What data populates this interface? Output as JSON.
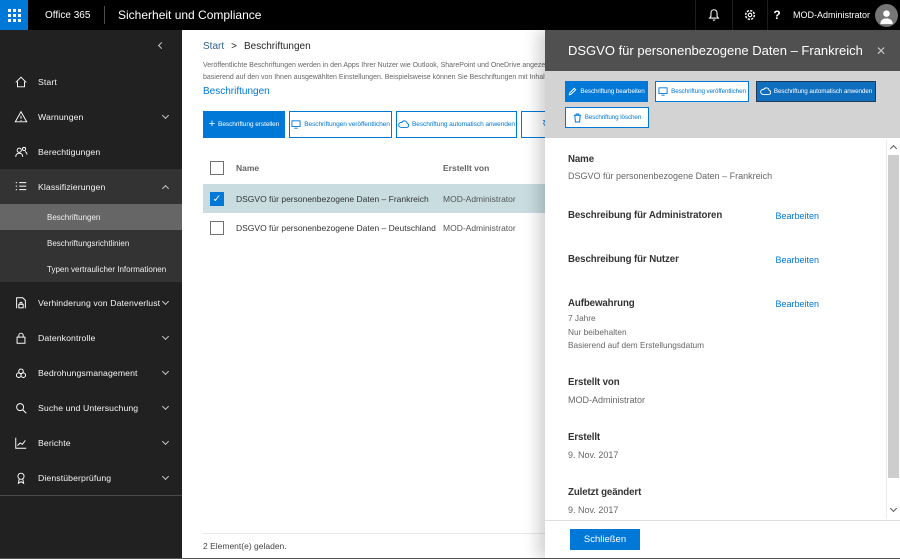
{
  "topbar": {
    "brand": "Office 365",
    "product": "Sicherheit und Compliance",
    "user": "MOD-Administrator",
    "help": "?"
  },
  "sidebar": {
    "items": [
      {
        "label": "Start"
      },
      {
        "label": "Warnungen"
      },
      {
        "label": "Berechtigungen"
      },
      {
        "label": "Klassifizierungen"
      },
      {
        "label": "Verhinderung von Datenverlust"
      },
      {
        "label": "Datenkontrolle"
      },
      {
        "label": "Bedrohungsmanagement"
      },
      {
        "label": "Suche und Untersuchung"
      },
      {
        "label": "Berichte"
      },
      {
        "label": "Dienstüberprüfung"
      }
    ],
    "klassifizierungen_children": [
      {
        "label": "Beschriftungen",
        "selected": true
      },
      {
        "label": "Beschriftungsrichtlinien",
        "selected": false
      },
      {
        "label": "Typen vertraulicher Informationen",
        "selected": false
      }
    ]
  },
  "main": {
    "breadcrumb": {
      "home": "Start",
      "separator": ">",
      "current": "Beschriftungen"
    },
    "description_line1": "Veröffentlichte Beschriftungen werden in den Apps Ihrer Nutzer wie Outlook, SharePoint und OneDrive angezeigt,",
    "description_line2": "basierend auf den von Ihnen ausgewählten Einstellungen. Beispielsweise können Sie Beschriftungen mit Inhalten",
    "link": "Beschriftungen",
    "buttons": {
      "create": "Beschriftung erstellen",
      "publish": "Beschriftungen veröffentlichen",
      "auto_apply": "Beschriftung automatisch anwenden",
      "refresh": "Aktualisieren"
    },
    "table": {
      "columns": {
        "name": "Name",
        "created_by": "Erstellt von"
      },
      "rows": [
        {
          "name": "DSGVO für personenbezogene Daten – Frankreich",
          "created_by": "MOD-Administrator",
          "selected": true
        },
        {
          "name": "DSGVO für personenbezogene Daten – Deutschland",
          "created_by": "MOD-Administrator",
          "selected": false
        }
      ]
    },
    "status": "2 Element(e) geladen."
  },
  "panel": {
    "title": "DSGVO für personenbezogene Daten – Frankreich",
    "buttons": {
      "edit": "Beschriftung bearbeiten",
      "publish": "Beschriftung veröffentlichen",
      "auto_apply": "Beschriftung automatisch anwenden",
      "delete": "Beschriftung löschen"
    },
    "sections": {
      "name": {
        "label": "Name",
        "value": "DSGVO für personenbezogene Daten – Frankreich"
      },
      "admin_desc": {
        "label": "Beschreibung für Administratoren",
        "action": "Bearbeiten"
      },
      "user_desc": {
        "label": "Beschreibung für Nutzer",
        "action": "Bearbeiten"
      },
      "retention": {
        "label": "Aufbewahrung",
        "action": "Bearbeiten",
        "values": [
          "7 Jahre",
          "Nur beibehalten",
          "Basierend auf dem Erstellungsdatum"
        ]
      },
      "created_by": {
        "label": "Erstellt von",
        "value": "MOD-Administrator"
      },
      "created": {
        "label": "Erstellt",
        "value": "9. Nov. 2017"
      },
      "modified": {
        "label": "Zuletzt geändert",
        "value": "9. Nov. 2017"
      }
    },
    "close": "Schließen"
  },
  "colors": {
    "accent": "#0078d7",
    "selected_row": "#c9dde1",
    "panel_header": "#505050",
    "sidebar": "#212121"
  }
}
